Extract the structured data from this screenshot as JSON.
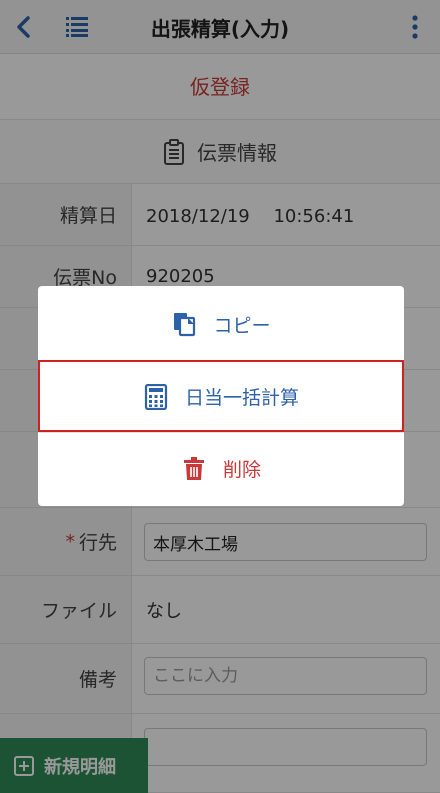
{
  "header": {
    "title": "出張精算(入力)"
  },
  "status": {
    "label": "仮登録"
  },
  "section": {
    "title": "伝票情報"
  },
  "fields": [
    {
      "label": "精算日",
      "value": "2018/12/19　 10:56:41"
    },
    {
      "label": "伝票No",
      "value": "920205"
    },
    {
      "label": "行先",
      "value": "本厚木工場",
      "required_mark": "*"
    },
    {
      "label": "ファイル",
      "value": "なし"
    },
    {
      "label": "備考",
      "placeholder": "ここに入力"
    }
  ],
  "fab": {
    "label": "新規明細"
  },
  "menu": {
    "items": [
      {
        "label": "コピー",
        "icon": "copy-icon"
      },
      {
        "label": "日当一括計算",
        "icon": "calculator-icon"
      },
      {
        "label": "削除",
        "icon": "trash-icon"
      }
    ]
  },
  "colors": {
    "accent": "#2e62a8",
    "danger": "#c83a3a",
    "fab": "#2e8b57",
    "highlight": "#d02020"
  }
}
